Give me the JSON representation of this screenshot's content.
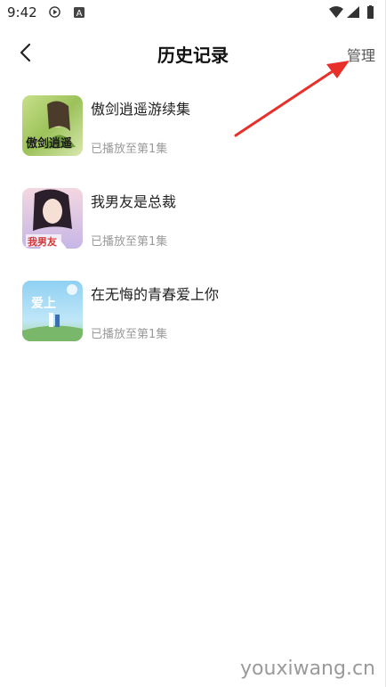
{
  "status_bar": {
    "time": "9:42",
    "icons": [
      "play-circle-icon",
      "font-a-icon",
      "wifi-icon",
      "signal-icon",
      "battery-icon"
    ]
  },
  "header": {
    "title": "历史记录",
    "manage_label": "管理",
    "back_icon": "chevron-left-icon"
  },
  "history": [
    {
      "title": "傲剑逍遥游续集",
      "progress": "已播放至第1集",
      "cover_text": "傲剑逍遥游"
    },
    {
      "title": "我男友是总裁",
      "progress": "已播放至第1集",
      "cover_text": "我男友是总裁"
    },
    {
      "title": "在无悔的青春爱上你",
      "progress": "已播放至第1集",
      "cover_text": "爱上你"
    }
  ],
  "watermark": "youxiwang.cn",
  "colors": {
    "annotation_arrow": "#e8302a",
    "secondary_text": "#9a9a9a"
  }
}
